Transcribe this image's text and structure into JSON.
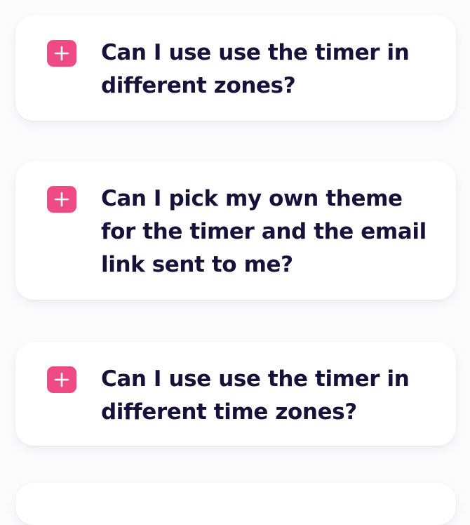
{
  "faq": {
    "items": [
      {
        "question": "Can I use use the timer in different zones?",
        "expanded": false
      },
      {
        "question": "Can I pick my own theme for the timer and the email link sent to me?",
        "expanded": false
      },
      {
        "question": "Can I use use the timer in different time zones?",
        "expanded": false
      },
      {
        "question": "",
        "expanded": false
      }
    ],
    "toggle_icon": "plus-icon",
    "colors": {
      "accent": "#ef4a84",
      "question_text": "#16133b",
      "card_background": "#ffffff",
      "page_background": "#fdfcfd"
    }
  }
}
